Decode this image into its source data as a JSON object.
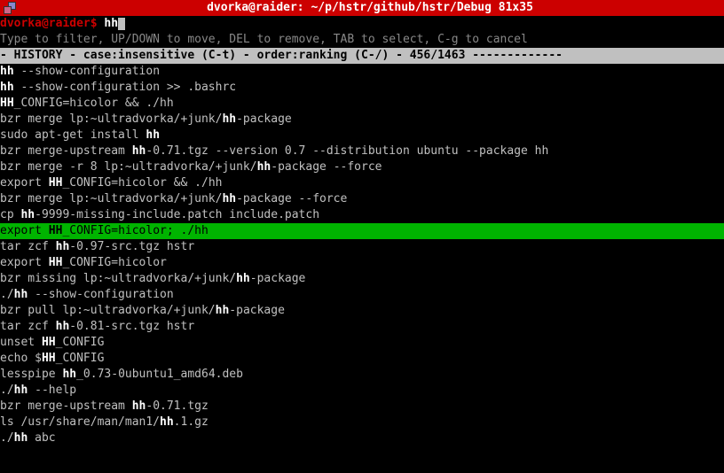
{
  "titlebar": {
    "title": "dvorka@raider: ~/p/hstr/github/hstr/Debug 81x35"
  },
  "prompt": {
    "user_host": "dvorka@raider$ ",
    "typed": "hh"
  },
  "hint": "Type to filter, UP/DOWN to move, DEL to remove, TAB to select, C-g to cancel",
  "status": {
    "lead": "- HISTORY - case:insensitive (C-t) - order:ranking (C-/) - ",
    "count": "456/1463",
    "tail": " -------------"
  },
  "history": [
    {
      "pre": "",
      "m": "hh",
      "post": " --show-configuration"
    },
    {
      "pre": "",
      "m": "hh",
      "post": " --show-configuration >> .bashrc"
    },
    {
      "pre": "",
      "m": "HH",
      "post": "_CONFIG=hicolor && ./hh"
    },
    {
      "pre": "bzr merge lp:~ultradvorka/+junk/",
      "m": "hh",
      "post": "-package"
    },
    {
      "pre": "sudo apt-get install ",
      "m": "hh",
      "post": ""
    },
    {
      "pre": "bzr merge-upstream ",
      "m": "hh",
      "post": "-0.71.tgz --version 0.7 --distribution ubuntu --package hh"
    },
    {
      "pre": "bzr merge -r 8 lp:~ultradvorka/+junk/",
      "m": "hh",
      "post": "-package --force"
    },
    {
      "pre": "export ",
      "m": "HH",
      "post": "_CONFIG=hicolor && ./hh"
    },
    {
      "pre": "bzr merge lp:~ultradvorka/+junk/",
      "m": "hh",
      "post": "-package --force"
    },
    {
      "pre": "cp ",
      "m": "hh",
      "post": "-9999-missing-include.patch include.patch"
    },
    {
      "pre": "export ",
      "m": "HH",
      "post": "_CONFIG=hicolor; ./hh",
      "selected": true
    },
    {
      "pre": "tar zcf ",
      "m": "hh",
      "post": "-0.97-src.tgz hstr"
    },
    {
      "pre": "export ",
      "m": "HH",
      "post": "_CONFIG=hicolor"
    },
    {
      "pre": "bzr missing lp:~ultradvorka/+junk/",
      "m": "hh",
      "post": "-package"
    },
    {
      "pre": "./",
      "m": "hh",
      "post": " --show-configuration"
    },
    {
      "pre": "bzr pull lp:~ultradvorka/+junk/",
      "m": "hh",
      "post": "-package"
    },
    {
      "pre": "tar zcf ",
      "m": "hh",
      "post": "-0.81-src.tgz hstr"
    },
    {
      "pre": "unset ",
      "m": "HH",
      "post": "_CONFIG"
    },
    {
      "pre": "echo $",
      "m": "HH",
      "post": "_CONFIG"
    },
    {
      "pre": "lesspipe ",
      "m": "hh",
      "post": "_0.73-0ubuntu1_amd64.deb"
    },
    {
      "pre": "./",
      "m": "hh",
      "post": " --help"
    },
    {
      "pre": "bzr merge-upstream ",
      "m": "hh",
      "post": "-0.71.tgz"
    },
    {
      "pre": "ls /usr/share/man/man1/",
      "m": "hh",
      "post": ".1.gz"
    },
    {
      "pre": "./",
      "m": "hh",
      "post": " abc"
    }
  ]
}
